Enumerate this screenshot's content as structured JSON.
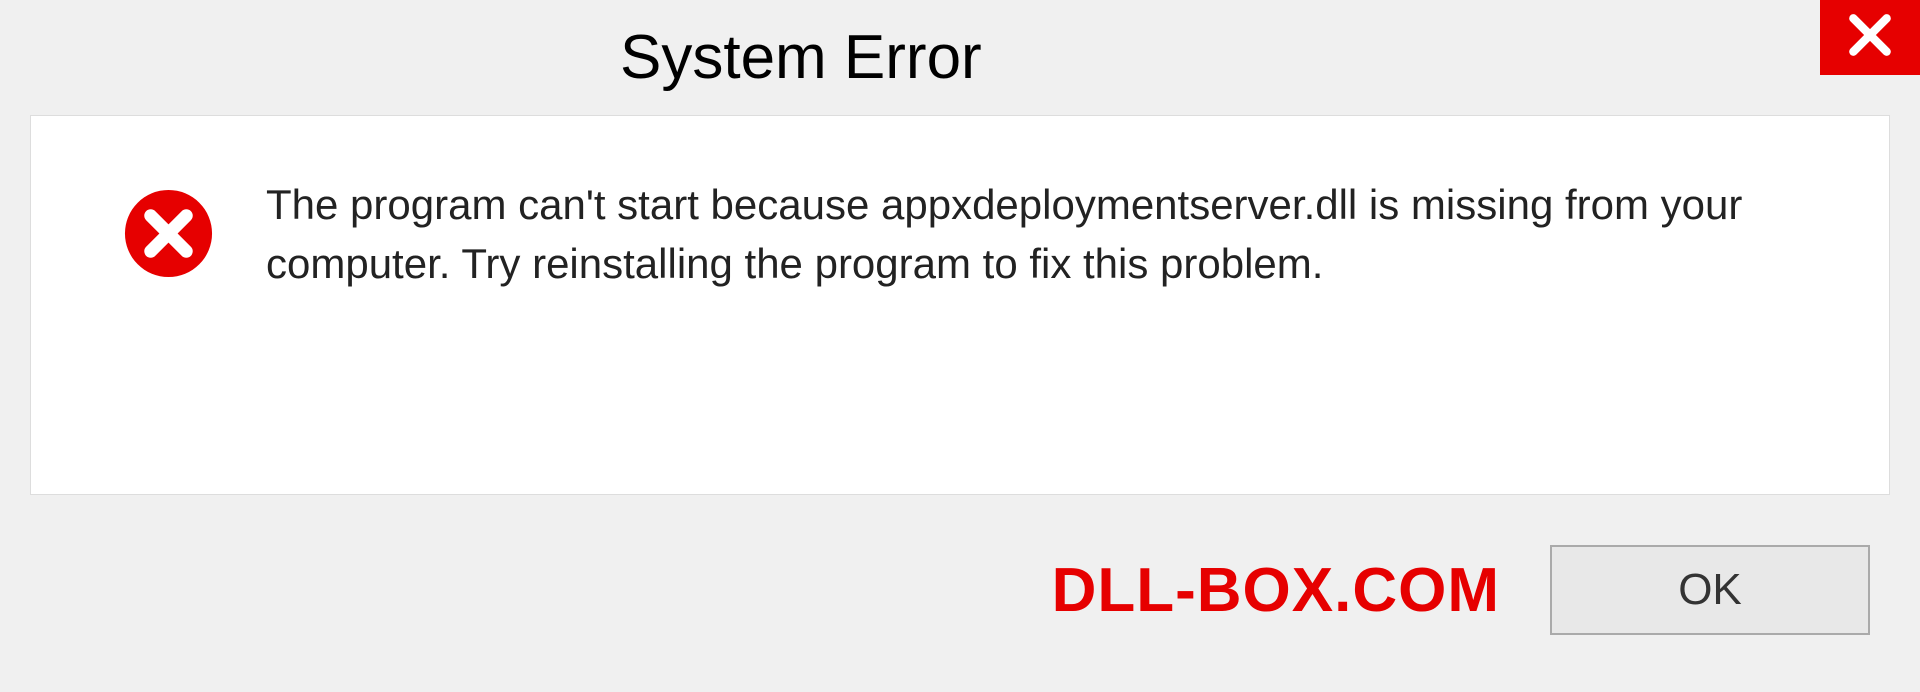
{
  "dialog": {
    "title": "System Error",
    "message": "The program can't start because appxdeploymentserver.dll is missing from your computer. Try reinstalling the program to fix this problem.",
    "ok_label": "OK"
  },
  "watermark": "DLL-BOX.COM"
}
